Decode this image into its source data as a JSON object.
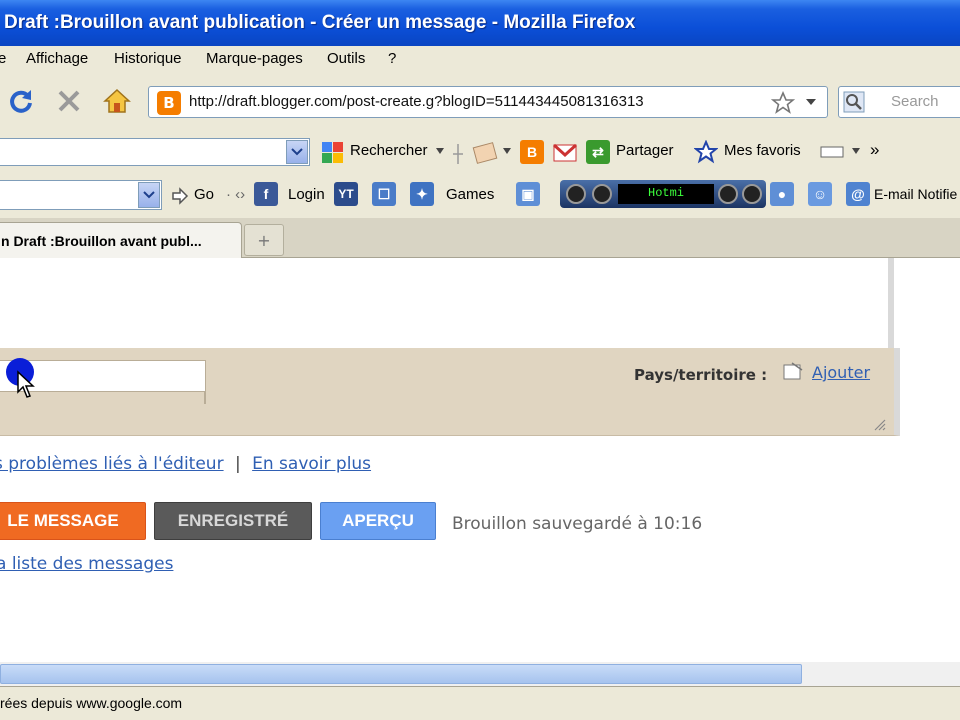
{
  "window": {
    "title": "Draft :Brouillon avant publication - Créer un message - Mozilla Firefox"
  },
  "menu": [
    {
      "label": "e"
    },
    {
      "label": "Affichage"
    },
    {
      "label": "Historique"
    },
    {
      "label": "Marque-pages"
    },
    {
      "label": "Outils"
    },
    {
      "label": "?"
    }
  ],
  "nav": {
    "url": "http://draft.blogger.com/post-create.g?blogID=511443445081316313",
    "search_placeholder": "Search"
  },
  "google_toolbar": {
    "search_label": "Rechercher",
    "share_label": "Partager",
    "favorites_label": "Mes favoris",
    "more": "»"
  },
  "toolbar2": {
    "go_label": "Go",
    "login_label": "Login",
    "games_label": "Games",
    "player_text": "Hotmi",
    "email_label": "E-mail Notifie"
  },
  "tab": {
    "label": "n Draft :Brouillon avant publ..."
  },
  "content": {
    "country_label": "Pays/territoire :",
    "add_link": "Ajouter",
    "help_problems": "s problèmes liés à l'éditeur",
    "help_sep": "|",
    "help_more": "En savoir plus",
    "buttons": {
      "publish": "LE MESSAGE",
      "saved": "ENREGISTRÉ",
      "preview": "APERÇU"
    },
    "draft_status": "Brouillon sauvegardé à 10:16",
    "back_link": "a liste des messages"
  },
  "status": {
    "text": "rées depuis www.google.com"
  },
  "colors": {
    "publish": "#f06a22",
    "saved": "#5a5a5a",
    "preview": "#6aa0f2",
    "link": "#2f5fb3",
    "panel": "#e0d5c1"
  }
}
